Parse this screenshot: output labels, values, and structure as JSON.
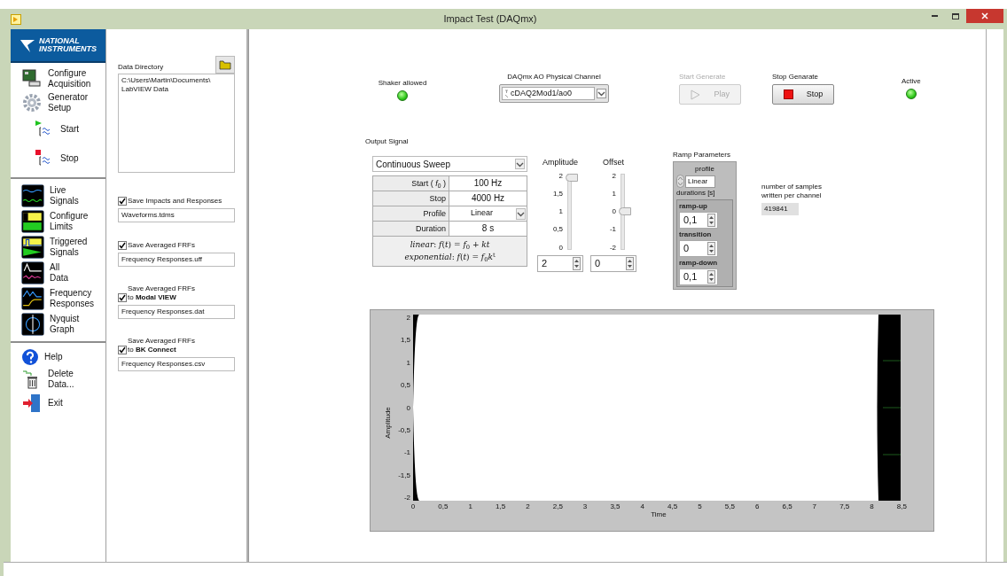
{
  "window": {
    "title": "Impact Test (DAQmx)"
  },
  "sidebar": {
    "logo": "NATIONAL\nINSTRUMENTS",
    "groups": [
      [
        {
          "kind": "acquisition",
          "label": "Configure\nAcquisition"
        },
        {
          "kind": "generator",
          "label": "Generator\nSetup"
        },
        {
          "kind": "start",
          "label": "Start"
        },
        {
          "kind": "stop",
          "label": "Stop"
        }
      ],
      [
        {
          "kind": "live",
          "label": "Live\nSignals"
        },
        {
          "kind": "limits",
          "label": "Configure\nLimits"
        },
        {
          "kind": "triggered",
          "label": "Triggered\nSignals"
        },
        {
          "kind": "all",
          "label": "All\nData"
        },
        {
          "kind": "frequency",
          "label": "Frequency\nResponses"
        },
        {
          "kind": "nyquist",
          "label": "Nyquist\nGraph"
        }
      ],
      [
        {
          "kind": "help",
          "label": "Help"
        },
        {
          "kind": "delete",
          "label": "Delete\nData..."
        },
        {
          "kind": "exit",
          "label": "Exit"
        }
      ]
    ]
  },
  "data_panel": {
    "directory_label": "Data Directory",
    "directory": "C:\\Users\\Martin\\Documents\\\nLabVIEW Data",
    "options": [
      {
        "kind": "inline",
        "label": "Save Impacts and Responses",
        "checked": true,
        "file": "Waveforms.tdms"
      },
      {
        "kind": "inline",
        "label": "Save Averaged FRFs",
        "checked": true,
        "file": "Frequency Responses.uff"
      },
      {
        "kind": "stacked",
        "caption": "Save Averaged FRFs",
        "label": "to **Modal VIEW**",
        "checked": true,
        "file": "Frequency Responses.dat"
      },
      {
        "kind": "stacked",
        "caption": "Save Averaged FRFs",
        "label": "to **BK Connect**",
        "checked": true,
        "file": "Frequency Responses.csv"
      }
    ]
  },
  "controls": {
    "shaker": {
      "label": "Shaker allowed",
      "on": true
    },
    "channel": {
      "label": "DAQmx AO Physical Channel",
      "value": "cDAQ2Mod1/ao0"
    },
    "start": {
      "label": "Start Generate",
      "button": "Play",
      "disabled": true
    },
    "stop": {
      "label": "Stop Genarate",
      "button": "Stop",
      "disabled": false
    },
    "active": {
      "label": "Active",
      "on": true
    }
  },
  "output_signal": {
    "label": "Output Signal",
    "type": "Continuous Sweep",
    "params": [
      {
        "kind": "value",
        "label": "Start ( *f*$_{0}$ )",
        "value": "100 Hz"
      },
      {
        "kind": "value",
        "label": "Stop",
        "value": "4000 Hz"
      },
      {
        "kind": "dropdown",
        "label": "Profile",
        "value": "Linear"
      },
      {
        "kind": "value",
        "label": "Duration",
        "value": "8 s"
      }
    ],
    "formulas": [
      "*linear*: *f*(*t*) = *f*$_{0}$ + *kt*",
      "*exponential*: *f*(*t*) = *f*$_{0}$*k*$^{t}$"
    ],
    "sliders": [
      {
        "label": "Amplitude",
        "ticks": [
          "2",
          "1,5",
          "1",
          "0,5",
          "0"
        ],
        "level": 1,
        "value": "2"
      },
      {
        "label": "Offset",
        "ticks": [
          "2",
          "1",
          "0",
          "-1",
          "-2"
        ],
        "level": 0.5,
        "value": "0"
      }
    ]
  },
  "ramp": {
    "label": "Ramp Parameters",
    "profile_label": "profile",
    "profile": "Linear",
    "durations_label": "durations [s]",
    "fields": [
      {
        "label": "ramp-up",
        "value": "0,1"
      },
      {
        "label": "transition",
        "value": "0"
      },
      {
        "label": "ramp-down",
        "value": "0,1"
      }
    ]
  },
  "samples": {
    "label": "number of samples\nwritten per channel",
    "value": "419841"
  },
  "graph": {
    "ylabel": "Amplitude",
    "xlabel": "Time",
    "yticks": [
      "2",
      "1,5",
      "1",
      "0,5",
      "0",
      "-0,5",
      "-1",
      "-1,5",
      "-2"
    ],
    "xticks": [
      "0",
      "0,5",
      "1",
      "1,5",
      "2",
      "2,5",
      "3",
      "3,5",
      "4",
      "4,5",
      "5",
      "5,5",
      "6",
      "6,5",
      "7",
      "7,5",
      "8",
      "8,5"
    ]
  }
}
